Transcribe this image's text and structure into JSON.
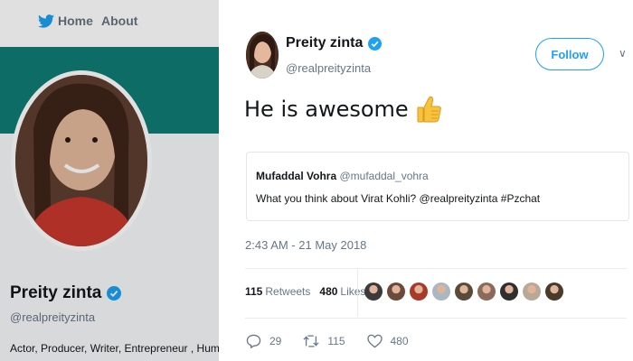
{
  "nav": {
    "home_label": "Home",
    "about_label": "About"
  },
  "profile": {
    "name": "Preity zinta",
    "handle": "@realpreityzinta",
    "bio": "Actor, Producer, Writer, Entrepreneur , Human"
  },
  "tweet": {
    "author_name": "Preity zinta",
    "author_handle": "@realpreityzinta",
    "follow_label": "Follow",
    "more_icon": "chevron-down-icon",
    "text": "He is awesome",
    "emoji": "thumbs-up-icon",
    "quote": {
      "author_name": "Mufaddal Vohra",
      "author_handle": "@mufaddal_vohra",
      "text": "What you think about Virat Kohli? @realpreityzinta #Pzchat"
    },
    "timestamp": "2:43 AM - 21 May 2018",
    "retweets_count": "115",
    "retweets_label": "Retweets",
    "likes_count": "480",
    "likes_label": "Likes",
    "likers": [
      "#3b3b3b",
      "#6a4a3a",
      "#a83a2a",
      "#aab8c2",
      "#5a4a3a",
      "#8a6a5a",
      "#2f2f2f",
      "#b8a898",
      "#4a3a2a"
    ],
    "actions": {
      "reply_count": "29",
      "retweet_count": "115",
      "like_count": "480"
    }
  },
  "colors": {
    "accent": "#1da1f2",
    "banner": "#0f7b73",
    "muted_text": "#657786",
    "badge": "#1da1f2"
  }
}
